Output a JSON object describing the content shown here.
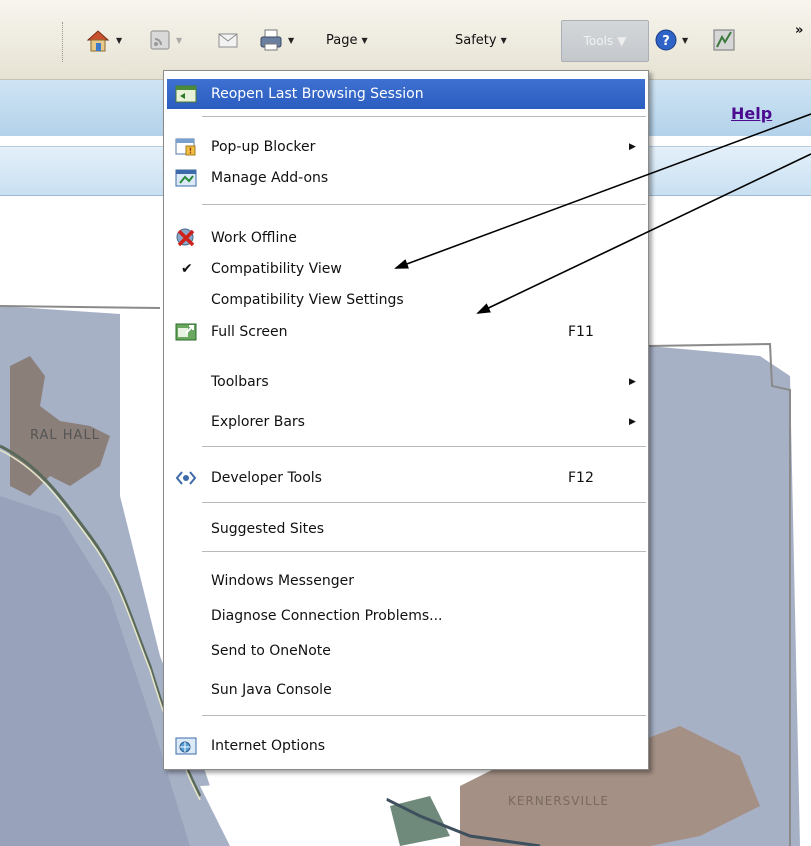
{
  "toolbar": {
    "page_label": "Page",
    "safety_label": "Safety",
    "tools_label": "Tools",
    "overflow_label": "»"
  },
  "page": {
    "help_link": "Help",
    "map_label_1": "RAL HALL",
    "map_label_2": "KERNERSVILLE"
  },
  "menu": {
    "items": [
      {
        "label": "Reopen Last Browsing Session",
        "icon": "reopen-session-icon"
      },
      {
        "label": "Pop-up Blocker",
        "icon": "popup-blocker-icon",
        "submenu": true
      },
      {
        "label": "Manage Add-ons",
        "icon": "manage-addons-icon"
      },
      {
        "label": "Work Offline",
        "icon": "work-offline-icon"
      },
      {
        "label": "Compatibility View",
        "checked": true
      },
      {
        "label": "Compatibility View Settings"
      },
      {
        "label": "Full Screen",
        "icon": "full-screen-icon",
        "shortcut": "F11"
      },
      {
        "label": "Toolbars",
        "submenu": true
      },
      {
        "label": "Explorer Bars",
        "submenu": true
      },
      {
        "label": "Developer Tools",
        "icon": "developer-tools-icon",
        "shortcut": "F12"
      },
      {
        "label": "Suggested Sites"
      },
      {
        "label": "Windows Messenger"
      },
      {
        "label": "Diagnose Connection Problems..."
      },
      {
        "label": "Send to OneNote"
      },
      {
        "label": "Sun Java Console"
      },
      {
        "label": "Internet Options",
        "icon": "internet-options-icon"
      }
    ]
  },
  "colors": {
    "menu_highlight": "#3465c8",
    "help_link": "#4b0a8f",
    "annotation_arrow": "#000000"
  }
}
